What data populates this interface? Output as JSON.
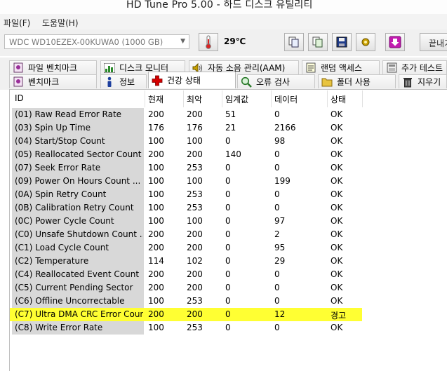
{
  "window": {
    "title": "HD Tune Pro 5.00 - 하드 디스크 유틸리티"
  },
  "menu": {
    "file": "파일(F)",
    "help": "도움말(H)"
  },
  "toolbar": {
    "drive": "WDC  WD10EZEX-00KUWA0 (1000 GB)",
    "temperature": "29℃",
    "exit_label": "끝내기"
  },
  "tabs_row1": [
    {
      "label": "파일 벤치마크",
      "icon": "file-benchmark-icon"
    },
    {
      "label": "디스크 모니터",
      "icon": "chart-icon"
    },
    {
      "label": "자동 소음 관리(AAM)",
      "icon": "speaker-icon"
    },
    {
      "label": "랜덤 액세스",
      "icon": "random-access-icon"
    },
    {
      "label": "추가 테스트",
      "icon": "extra-tests-icon"
    }
  ],
  "tabs_row2": [
    {
      "label": "벤치마크",
      "icon": "benchmark-icon"
    },
    {
      "label": "정보",
      "icon": "info-icon"
    },
    {
      "label": "건강 상태",
      "icon": "health-cross-icon",
      "active": true
    },
    {
      "label": "오류 검사",
      "icon": "magnifier-icon"
    },
    {
      "label": "폴더 사용",
      "icon": "folder-icon"
    },
    {
      "label": "지우기",
      "icon": "trash-icon"
    }
  ],
  "columns": {
    "id": "ID",
    "current": "현재",
    "worst": "최악",
    "threshold": "임계값",
    "data": "데이터",
    "status": "상태"
  },
  "rows": [
    {
      "id": "(01) Raw Read Error Rate",
      "current": "200",
      "worst": "200",
      "threshold": "51",
      "data": "0",
      "status": "OK"
    },
    {
      "id": "(03) Spin Up Time",
      "current": "176",
      "worst": "176",
      "threshold": "21",
      "data": "2166",
      "status": "OK"
    },
    {
      "id": "(04) Start/Stop Count",
      "current": "100",
      "worst": "100",
      "threshold": "0",
      "data": "98",
      "status": "OK"
    },
    {
      "id": "(05) Reallocated Sector Count",
      "current": "200",
      "worst": "200",
      "threshold": "140",
      "data": "0",
      "status": "OK"
    },
    {
      "id": "(07) Seek Error Rate",
      "current": "100",
      "worst": "253",
      "threshold": "0",
      "data": "0",
      "status": "OK"
    },
    {
      "id": "(09) Power On Hours Count   ...",
      "current": "100",
      "worst": "100",
      "threshold": "0",
      "data": "199",
      "status": "OK"
    },
    {
      "id": "(0A) Spin Retry Count",
      "current": "100",
      "worst": "253",
      "threshold": "0",
      "data": "0",
      "status": "OK"
    },
    {
      "id": "(0B) Calibration Retry Count",
      "current": "100",
      "worst": "253",
      "threshold": "0",
      "data": "0",
      "status": "OK"
    },
    {
      "id": "(0C) Power Cycle Count",
      "current": "100",
      "worst": "100",
      "threshold": "0",
      "data": "97",
      "status": "OK"
    },
    {
      "id": "(C0) Unsafe Shutdown Count   ...",
      "current": "200",
      "worst": "200",
      "threshold": "0",
      "data": "2",
      "status": "OK"
    },
    {
      "id": "(C1) Load Cycle Count",
      "current": "200",
      "worst": "200",
      "threshold": "0",
      "data": "95",
      "status": "OK"
    },
    {
      "id": "(C2) Temperature",
      "current": "114",
      "worst": "102",
      "threshold": "0",
      "data": "29",
      "status": "OK"
    },
    {
      "id": "(C4) Reallocated Event Count",
      "current": "200",
      "worst": "200",
      "threshold": "0",
      "data": "0",
      "status": "OK"
    },
    {
      "id": "(C5) Current Pending Sector",
      "current": "200",
      "worst": "200",
      "threshold": "0",
      "data": "0",
      "status": "OK"
    },
    {
      "id": "(C6) Offline Uncorrectable",
      "current": "100",
      "worst": "253",
      "threshold": "0",
      "data": "0",
      "status": "OK"
    },
    {
      "id": "(C7) Ultra DMA CRC Error Coun...",
      "current": "200",
      "worst": "200",
      "threshold": "0",
      "data": "12",
      "status": "경고",
      "highlight": true
    },
    {
      "id": "(C8) Write Error Rate",
      "current": "100",
      "worst": "253",
      "threshold": "0",
      "data": "0",
      "status": "OK"
    }
  ],
  "colors": {
    "warning_highlight": "#ffff33",
    "accent_tab": "#cc0000"
  }
}
